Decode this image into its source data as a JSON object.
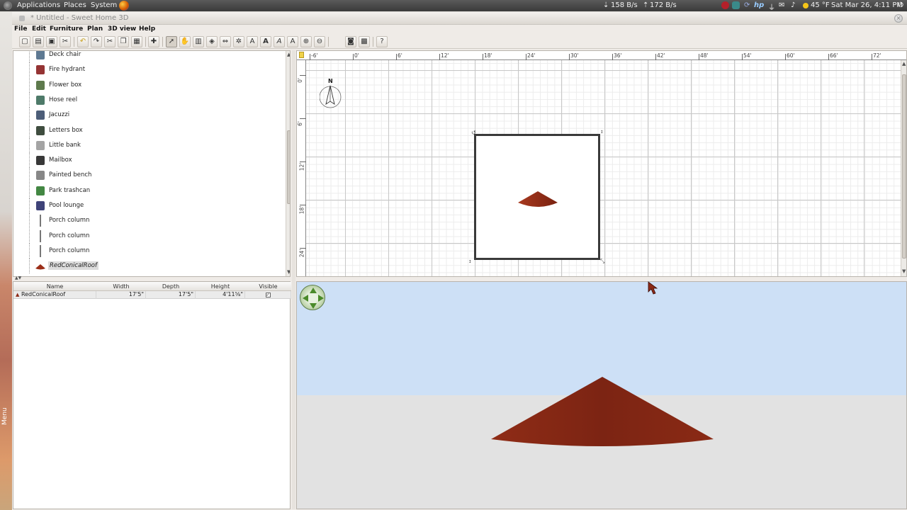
{
  "top_panel": {
    "menus": [
      "Applications",
      "Places",
      "System"
    ],
    "net_down": "158 B/s",
    "net_up": "172 B/s",
    "weather": "45 °F",
    "clock": "Sat Mar 26,  4:11 PM"
  },
  "window": {
    "title": "* Untitled - Sweet Home 3D"
  },
  "menubar": [
    "File",
    "Edit",
    "Furniture",
    "Plan",
    "3D view",
    "Help"
  ],
  "toolbar_icons": [
    "new-icon",
    "open-icon",
    "save-icon",
    "cut-tool-icon",
    "undo-icon",
    "redo-icon",
    "cut-icon",
    "copy-icon",
    "paste-icon",
    "add-furniture-icon",
    "select-icon",
    "pan-icon",
    "create-walls-icon",
    "create-rooms-icon",
    "create-dimensions-icon",
    "create-labels-icon",
    "add-text-icon",
    "text-style-icon",
    "text-style-2-icon",
    "text-style-3-icon",
    "zoom-in-icon",
    "zoom-out-icon",
    "create-photo-icon",
    "create-video-icon",
    "help-icon"
  ],
  "catalog": {
    "items": [
      {
        "label": "Deck chair",
        "icon": "deck-chair-icon"
      },
      {
        "label": "Fire hydrant",
        "icon": "fire-hydrant-icon"
      },
      {
        "label": "Flower box",
        "icon": "flower-box-icon"
      },
      {
        "label": "Hose reel",
        "icon": "hose-reel-icon"
      },
      {
        "label": "Jacuzzi",
        "icon": "jacuzzi-icon"
      },
      {
        "label": "Letters box",
        "icon": "letters-box-icon"
      },
      {
        "label": "Little bank",
        "icon": "little-bank-icon"
      },
      {
        "label": "Mailbox",
        "icon": "mailbox-icon"
      },
      {
        "label": "Painted bench",
        "icon": "painted-bench-icon"
      },
      {
        "label": "Park trashcan",
        "icon": "park-trashcan-icon"
      },
      {
        "label": "Pool lounge",
        "icon": "pool-lounge-icon"
      },
      {
        "label": "Porch column",
        "icon": "porch-column-icon"
      },
      {
        "label": "Porch column",
        "icon": "porch-column-icon"
      },
      {
        "label": "Porch column",
        "icon": "porch-column-icon"
      },
      {
        "label": "RedConicalRoof",
        "icon": "red-conical-roof-icon"
      }
    ],
    "selected_index": 14
  },
  "furniture_table": {
    "columns": [
      "Name",
      "Width",
      "Depth",
      "Height",
      "Visible"
    ],
    "rows": [
      {
        "name": "RedConicalRoof",
        "width": "17'5\"",
        "depth": "17'5\"",
        "height": "4'11⅝\"",
        "visible": true
      }
    ]
  },
  "plan": {
    "ruler_x": [
      "-6'",
      "0'",
      "6'",
      "12'",
      "18'",
      "24'",
      "30'",
      "36'",
      "42'",
      "48'",
      "54'",
      "60'",
      "66'",
      "72'"
    ],
    "ruler_y": [
      "0'",
      "6'",
      "12'",
      "18'",
      "24'"
    ],
    "compass_label": "N"
  },
  "desktop": {
    "side_label": "Menu"
  },
  "colors": {
    "roof": "#8b2a17",
    "sky": "#cde0f6",
    "ground": "#e2e2e2"
  }
}
